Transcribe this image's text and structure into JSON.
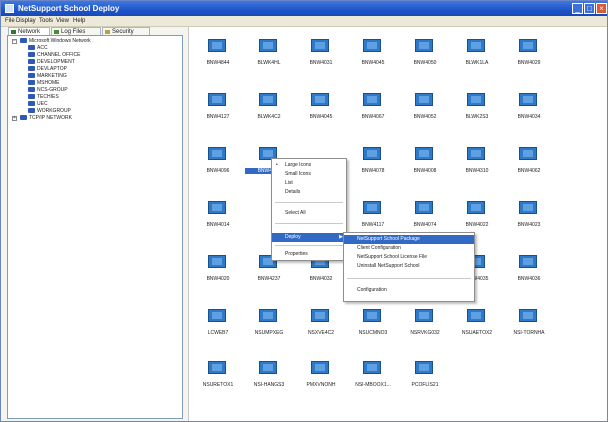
{
  "window": {
    "title": "NetSupport School Deploy"
  },
  "menubar": [
    "File",
    "Display",
    "Tools",
    "View",
    "Help"
  ],
  "tabs": [
    {
      "label": "Network"
    },
    {
      "label": "Log Files"
    },
    {
      "label": "Security"
    }
  ],
  "tree": {
    "root": "Microsoft Windows Network",
    "items": [
      "ACC",
      "CHANNEL OFFICE",
      "DEVELOPMENT",
      "DEVLAPTOP",
      "MARKETING",
      "MSHOME",
      "NCS-GROUP",
      "TECHIES",
      "UEC",
      "WORKGROUP"
    ],
    "second_root": "TCP/IP NETWORK"
  },
  "clients": [
    "BNW4844",
    "BLWK4HL",
    "BNW4031",
    "BNW4045",
    "BNW4050",
    "BLWK1LA",
    "BNW4029",
    "BNW4127",
    "BLWK4C2",
    "BNW4045",
    "BNW4067",
    "BNW4052",
    "BLWK2S3",
    "BNW4034",
    "BNW4096",
    "BNW4163",
    "",
    "BNW4078",
    "BNW4008",
    "BNW4310",
    "BNW4062",
    "BNW4014",
    "",
    "",
    "BNW4117",
    "BNW4074",
    "BNW4022",
    "BNW4023",
    "BNW4020",
    "BNW4237",
    "BNW4032",
    "",
    "",
    "BNW4035",
    "BNW4036",
    "LCWEB7",
    "NSUMPXEG",
    "NSXVE4C2",
    "NSUCMNO3",
    "NSRVKG032",
    "NSUAETOX2",
    "NSI-TORNHA",
    "NSURETOX1",
    "NSI-HANGS3",
    "PMXVNONH",
    "NSI-MBOOX1...",
    "PCOFLIS21"
  ],
  "context_menu": {
    "items": [
      "Large Icons",
      "Small Icons",
      "List",
      "Details",
      "Select All",
      "Deploy",
      "Properties"
    ]
  },
  "deploy_submenu": {
    "items": [
      "NetSupport School Package",
      "Client Configuration",
      "NetSupport School License File",
      "Uninstall NetSupport School",
      "Configuration"
    ]
  }
}
